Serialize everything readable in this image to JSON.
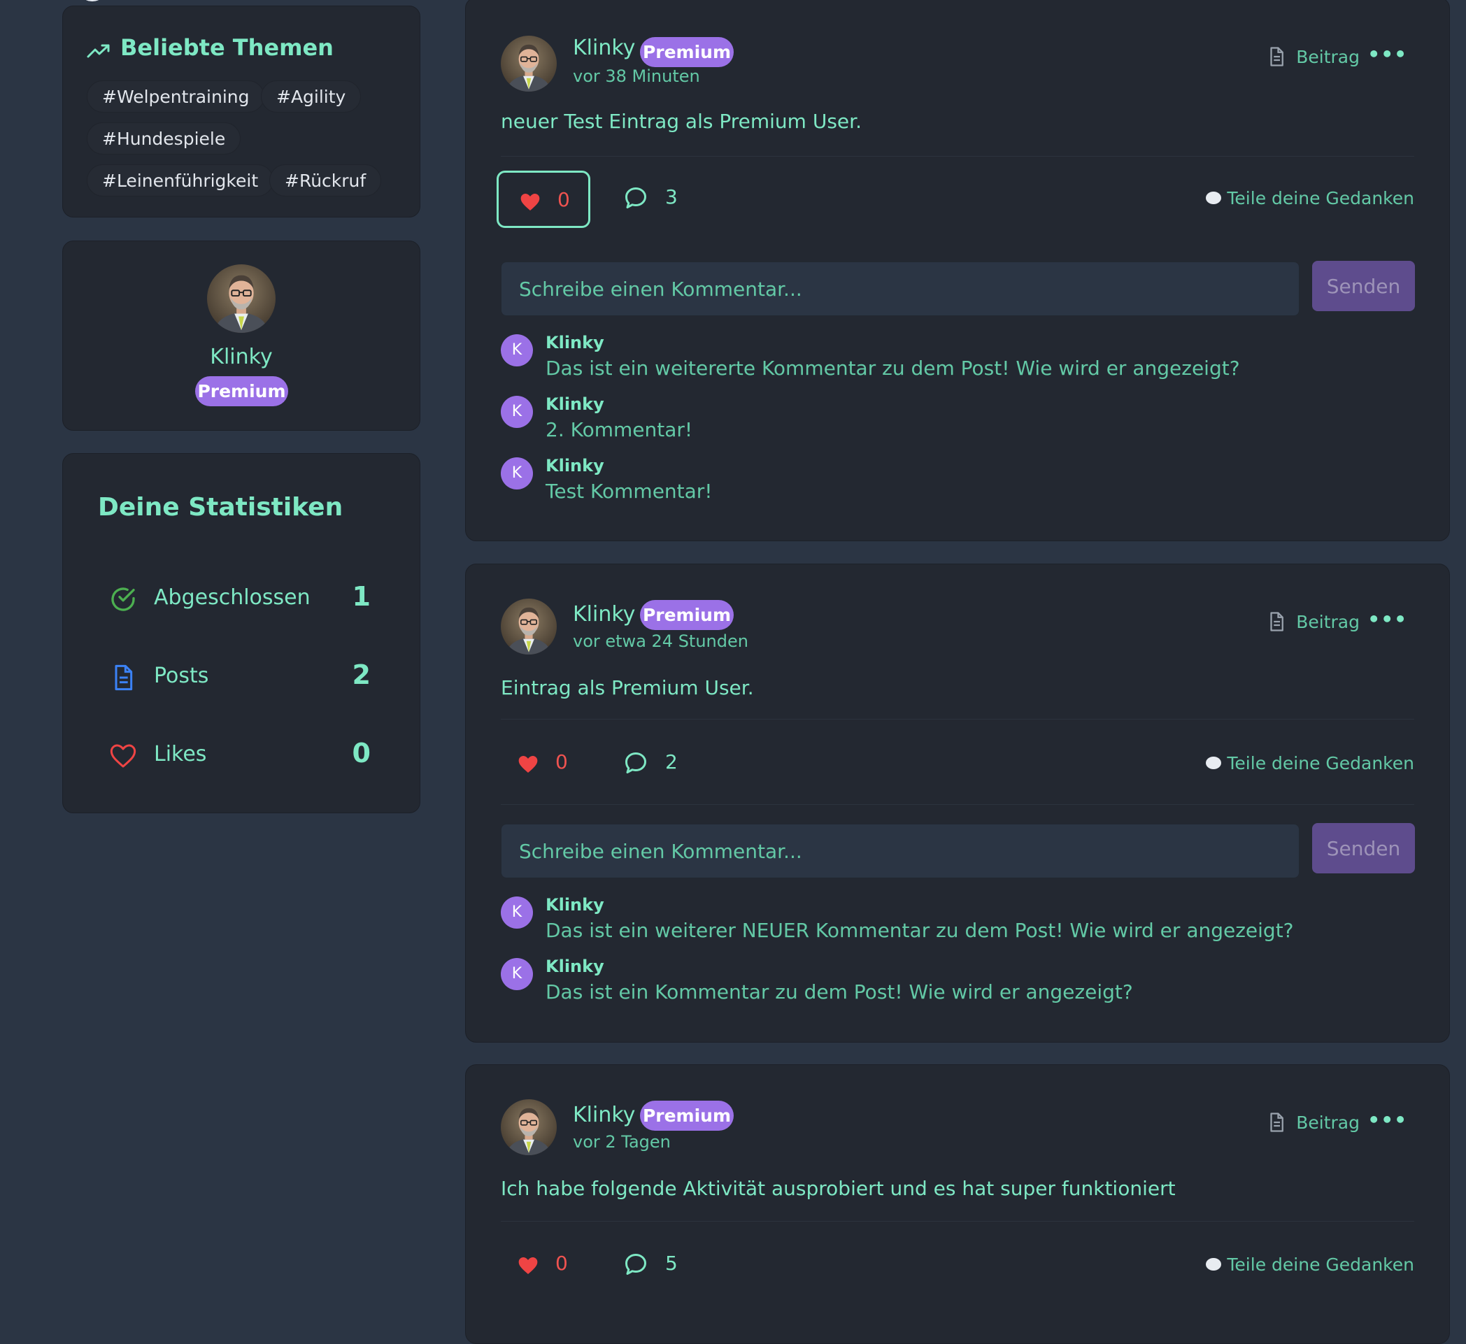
{
  "topics": {
    "title": "Beliebte Themen",
    "tags": [
      "#Welpentraining",
      "#Agility",
      "#Hundespiele",
      "#Leinenführigkeit",
      "#Rückruf"
    ]
  },
  "profile": {
    "name": "Klinky",
    "badge": "Premium"
  },
  "stats": {
    "title": "Deine Statistiken",
    "rows": [
      {
        "label": "Abgeschlossen",
        "value": "1"
      },
      {
        "label": "Posts",
        "value": "2"
      },
      {
        "label": "Likes",
        "value": "0"
      }
    ]
  },
  "common": {
    "post_type": "Beitrag",
    "share_label": "Teile deine Gedanken",
    "comment_placeholder": "Schreibe einen Kommentar...",
    "send_label": "Senden",
    "more_label": "•••"
  },
  "posts": [
    {
      "author": "Klinky",
      "badge": "Premium",
      "time": "vor 38 Minuten",
      "text": "neuer Test Eintrag als Premium User.",
      "likes": "0",
      "comments_count": "3",
      "comments": [
        {
          "initial": "K",
          "author": "Klinky",
          "text": "Das ist ein weitererte Kommentar zu dem Post! Wie wird er angezeigt?"
        },
        {
          "initial": "K",
          "author": "Klinky",
          "text": "2. Kommentar!"
        },
        {
          "initial": "K",
          "author": "Klinky",
          "text": "Test Kommentar!"
        }
      ]
    },
    {
      "author": "Klinky",
      "badge": "Premium",
      "time": "vor etwa 24 Stunden",
      "text": "Eintrag als Premium User.",
      "likes": "0",
      "comments_count": "2",
      "comments": [
        {
          "initial": "K",
          "author": "Klinky",
          "text": "Das ist ein weiterer NEUER Kommentar zu dem Post! Wie wird er angezeigt?"
        },
        {
          "initial": "K",
          "author": "Klinky",
          "text": "Das ist ein Kommentar zu dem Post! Wie wird er angezeigt?"
        }
      ]
    },
    {
      "author": "Klinky",
      "badge": "Premium",
      "time": "vor 2 Tagen",
      "text": "Ich habe folgende Aktivität ausprobiert und es hat super funktioniert",
      "likes": "0",
      "comments_count": "5",
      "comments": []
    }
  ]
}
